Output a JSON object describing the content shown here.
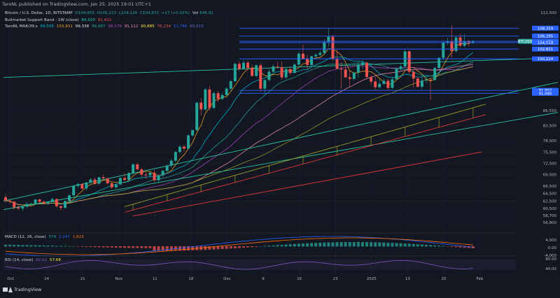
{
  "header": {
    "published": "TaroNL published on TradingView.com, Jan 25, 2025 19:01 UTC+1"
  },
  "legend": {
    "main": {
      "title": "Bitcoin / U.S. Dollar, 1D, BITSTAMP",
      "ohlc": [
        "O104,855",
        "H105,223",
        "L104,126",
        "C104,872",
        "+17 (+0.02%)"
      ],
      "vol_label": "Vol",
      "vol_value": "645.91"
    },
    "bull_band": {
      "label": "Bullmarket Support Band - 1W (close)",
      "v1": "84,920",
      "v2": "81,422"
    },
    "ma_ribbon": {
      "label": "TaroNL MA8/39:s",
      "values": [
        "99.505",
        "103,831",
        "99,338",
        "98,887",
        "98,579",
        "91,112",
        "90,885",
        "76,234",
        "51,746",
        "65,819"
      ]
    }
  },
  "colors": {
    "bg": "#131722",
    "grid": "#1e2230",
    "up": "#26a69a",
    "down": "#ef5350",
    "hline": "#2962ff",
    "teal_line": "#26c6a0",
    "ma_orange": "#f7a21b",
    "ma_cyan": "#00bcd4",
    "ma_purple": "#ab47bc",
    "ma_pink": "#f48fb1",
    "ma_olive": "#9e9d24",
    "ma_red": "#e53935",
    "macd_line": "#2962ff",
    "signal_line": "#ff6d00",
    "rsi_line": "#7e57c2"
  },
  "chart_data": {
    "type": "candlestick",
    "symbol": "BTCUSD",
    "price_axis": {
      "ylim": [
        56800,
        112500
      ],
      "ticks": [
        112500,
        86550,
        82500,
        78500,
        75500,
        72500,
        69500,
        66500,
        64500,
        62500,
        60500,
        58700,
        56800
      ]
    },
    "x_axis": {
      "ticks": [
        "Oct",
        "14",
        "21",
        "Nov",
        "11",
        "18",
        "Dec",
        "9",
        "16",
        "23",
        "2025",
        "13",
        "20",
        "Feb"
      ]
    },
    "candles": [
      [
        0,
        63500,
        64200,
        62100,
        62600
      ],
      [
        1,
        62600,
        63100,
        61800,
        62300
      ],
      [
        2,
        62300,
        62500,
        60200,
        60800
      ],
      [
        3,
        60800,
        61400,
        60100,
        60500
      ],
      [
        4,
        60500,
        61100,
        59800,
        61000
      ],
      [
        5,
        61000,
        62200,
        60700,
        61700
      ],
      [
        6,
        61700,
        62100,
        61200,
        61800
      ],
      [
        7,
        61800,
        63000,
        61600,
        62900
      ],
      [
        8,
        62900,
        63100,
        62000,
        62300
      ],
      [
        9,
        62300,
        62600,
        61700,
        61900
      ],
      [
        10,
        61900,
        62400,
        61500,
        62200
      ],
      [
        11,
        62200,
        63400,
        61900,
        63000
      ],
      [
        12,
        63000,
        63200,
        60800,
        61100
      ],
      [
        13,
        61100,
        61300,
        60000,
        60700
      ],
      [
        14,
        60700,
        62600,
        60500,
        62500
      ],
      [
        15,
        62500,
        64200,
        62200,
        64000
      ],
      [
        16,
        64000,
        66800,
        63700,
        66500
      ],
      [
        17,
        66500,
        67300,
        66000,
        67000
      ],
      [
        18,
        67000,
        67200,
        65500,
        65800
      ],
      [
        19,
        65800,
        67600,
        65200,
        67400
      ],
      [
        20,
        67400,
        68600,
        66700,
        68200
      ],
      [
        21,
        68200,
        68700,
        66800,
        67100
      ],
      [
        22,
        67100,
        68900,
        66900,
        68800
      ],
      [
        23,
        68800,
        69500,
        68100,
        68500
      ],
      [
        24,
        68500,
        68700,
        66900,
        67200
      ],
      [
        25,
        67200,
        67600,
        65600,
        66100
      ],
      [
        26,
        66100,
        67100,
        65800,
        66900
      ],
      [
        27,
        66900,
        68800,
        66600,
        68600
      ],
      [
        28,
        68600,
        69900,
        67800,
        68100
      ],
      [
        29,
        68100,
        70200,
        68000,
        69900
      ],
      [
        30,
        69900,
        72500,
        69500,
        72200
      ],
      [
        31,
        72200,
        72700,
        70600,
        70900
      ],
      [
        32,
        70900,
        71300,
        68800,
        69500
      ],
      [
        33,
        69500,
        70100,
        68400,
        69300
      ],
      [
        34,
        69300,
        70300,
        68800,
        70000
      ],
      [
        35,
        70000,
        70800,
        67500,
        68000
      ],
      [
        36,
        68000,
        69600,
        67200,
        69300
      ],
      [
        37,
        69300,
        70700,
        68900,
        70500
      ],
      [
        38,
        70500,
        72200,
        70200,
        71900
      ],
      [
        39,
        71900,
        73600,
        71300,
        73200
      ],
      [
        40,
        73200,
        75800,
        72800,
        75500
      ],
      [
        41,
        75500,
        77300,
        75100,
        76900
      ],
      [
        42,
        76900,
        77400,
        75700,
        76400
      ],
      [
        43,
        76400,
        80200,
        76200,
        79900
      ],
      [
        44,
        79900,
        81500,
        79600,
        81300
      ],
      [
        45,
        81300,
        88800,
        81000,
        88600
      ],
      [
        46,
        88600,
        89800,
        85200,
        86800
      ],
      [
        47,
        86800,
        92500,
        86400,
        92100
      ],
      [
        48,
        92100,
        93100,
        86500,
        87200
      ],
      [
        49,
        87200,
        91600,
        86800,
        91100
      ],
      [
        50,
        91100,
        91700,
        88800,
        89600
      ],
      [
        51,
        89600,
        91200,
        89300,
        90600
      ],
      [
        52,
        90600,
        92700,
        90400,
        92300
      ],
      [
        53,
        92300,
        94600,
        91500,
        94300
      ],
      [
        54,
        94300,
        99200,
        94000,
        98900
      ],
      [
        55,
        98900,
        99600,
        97000,
        97600
      ],
      [
        56,
        97600,
        99900,
        97300,
        99200
      ],
      [
        57,
        99200,
        99800,
        97100,
        97800
      ],
      [
        58,
        97800,
        98700,
        95500,
        95700
      ],
      [
        59,
        95700,
        98800,
        95400,
        98500
      ],
      [
        60,
        98500,
        99100,
        91500,
        92300
      ],
      [
        61,
        92300,
        94800,
        90800,
        94600
      ],
      [
        62,
        94600,
        97500,
        94300,
        96800
      ],
      [
        63,
        96800,
        98800,
        96500,
        98200
      ],
      [
        64,
        98200,
        99400,
        97600,
        98000
      ],
      [
        65,
        98000,
        99500,
        94700,
        95300
      ],
      [
        66,
        95300,
        97800,
        94800,
        97500
      ],
      [
        67,
        97500,
        98200,
        95900,
        96500
      ],
      [
        68,
        96500,
        99100,
        96300,
        98700
      ],
      [
        69,
        98700,
        102000,
        98400,
        101600
      ],
      [
        70,
        101600,
        104000,
        100900,
        100200
      ],
      [
        71,
        100200,
        101300,
        97500,
        98600
      ],
      [
        72,
        98600,
        101100,
        98200,
        100900
      ],
      [
        73,
        100900,
        101700,
        100000,
        101300
      ],
      [
        74,
        101300,
        102500,
        100800,
        101800
      ],
      [
        75,
        101800,
        105400,
        101400,
        104700
      ],
      [
        76,
        104700,
        108300,
        103400,
        106100
      ],
      [
        77,
        106100,
        106500,
        99600,
        100200
      ],
      [
        78,
        100200,
        102800,
        99900,
        97600
      ],
      [
        79,
        97600,
        99400,
        92300,
        97400
      ],
      [
        80,
        97400,
        98500,
        95800,
        95300
      ],
      [
        81,
        95300,
        97200,
        92600,
        94900
      ],
      [
        82,
        94900,
        96800,
        94600,
        96600
      ],
      [
        83,
        96600,
        99400,
        95300,
        98700
      ],
      [
        84,
        98700,
        99900,
        97600,
        99200
      ],
      [
        85,
        99200,
        99600,
        94800,
        95400
      ],
      [
        86,
        95400,
        95700,
        93400,
        94200
      ],
      [
        87,
        94200,
        95300,
        91900,
        92700
      ],
      [
        88,
        92700,
        94800,
        92200,
        93600
      ],
      [
        89,
        93600,
        95000,
        93200,
        94400
      ],
      [
        90,
        94400,
        94900,
        92000,
        92500
      ],
      [
        91,
        92500,
        95500,
        92300,
        94800
      ],
      [
        92,
        94800,
        97900,
        94600,
        97600
      ],
      [
        93,
        97600,
        98900,
        97100,
        98200
      ],
      [
        94,
        98200,
        102700,
        97900,
        102200
      ],
      [
        95,
        102200,
        102500,
        96100,
        96800
      ],
      [
        96,
        96800,
        97300,
        92500,
        95000
      ],
      [
        97,
        95000,
        95300,
        92600,
        92800
      ],
      [
        98,
        92800,
        95900,
        92200,
        94500
      ],
      [
        99,
        94500,
        95600,
        93800,
        94700
      ],
      [
        100,
        94700,
        95100,
        89300,
        94600
      ],
      [
        101,
        94600,
        98100,
        94400,
        97800
      ],
      [
        102,
        97800,
        100700,
        97300,
        100500
      ],
      [
        103,
        100500,
        105000,
        99900,
        104500
      ],
      [
        104,
        104500,
        105800,
        103900,
        104800
      ],
      [
        105,
        104800,
        109100,
        100500,
        102300
      ],
      [
        106,
        102300,
        106300,
        101900,
        105900
      ],
      [
        107,
        105900,
        106900,
        103200,
        103700
      ],
      [
        108,
        103700,
        106800,
        103300,
        104800
      ],
      [
        109,
        104800,
        105300,
        103500,
        104600
      ],
      [
        110,
        104600,
        105200,
        104100,
        104872
      ]
    ],
    "horizontal_levels": [
      {
        "label": "108,359",
        "value": 108359
      },
      {
        "label": "106,295",
        "value": 106295
      },
      {
        "label": "104,872",
        "value": 104872
      },
      {
        "label": "104,519",
        "value": 104519
      },
      {
        "label": "102,821",
        "value": 102821
      },
      {
        "label": "100,224",
        "value": 100224
      },
      {
        "label": "91,857",
        "value": 91857
      },
      {
        "label": "91,085",
        "value": 91085
      }
    ],
    "current_price_label": "BTCUSD",
    "indicators": {
      "macd": {
        "label": "MACD (12, 26, close)",
        "values": [
          "574",
          "2,197",
          "1,623"
        ],
        "axis_ticks": [
          "4,000",
          "0.00",
          "-4,000"
        ]
      },
      "rsi": {
        "label": "RSI (14, close)",
        "values": [
          "60.62",
          "57.68"
        ],
        "axis_ticks": [
          "80.00",
          "40.00"
        ]
      }
    }
  }
}
